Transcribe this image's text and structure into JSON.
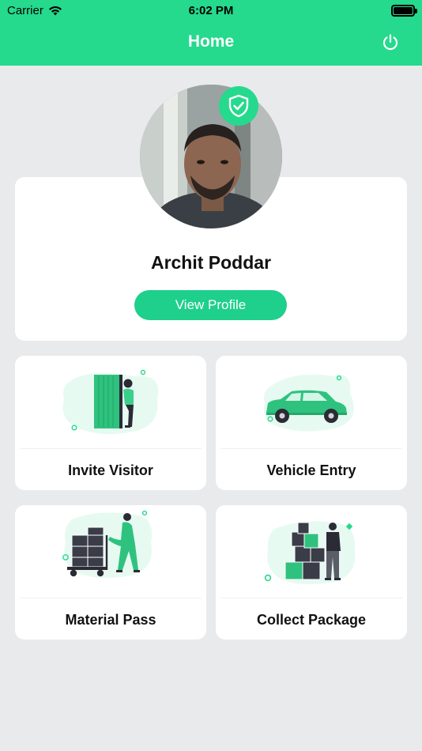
{
  "status_bar": {
    "carrier": "Carrier",
    "time": "6:02 PM"
  },
  "header": {
    "title": "Home"
  },
  "profile": {
    "name": "Archit Poddar",
    "button_label": "View Profile"
  },
  "tiles": [
    {
      "label": "Invite Visitor",
      "icon": "invite-visitor-illustration"
    },
    {
      "label": "Vehicle Entry",
      "icon": "vehicle-entry-illustration"
    },
    {
      "label": "Material Pass",
      "icon": "material-pass-illustration"
    },
    {
      "label": "Collect Package",
      "icon": "collect-package-illustration"
    }
  ],
  "colors": {
    "accent": "#25d98d",
    "button": "#1fcf8c",
    "background": "#e9eaec",
    "card": "#ffffff"
  }
}
